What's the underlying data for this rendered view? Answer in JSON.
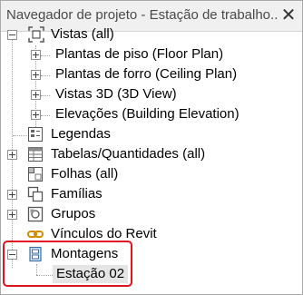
{
  "window": {
    "title": "Navegador de projeto - Estação de trabalho...",
    "close_glyph": "✕"
  },
  "tree": {
    "views": {
      "label": "Vistas (all)",
      "children": [
        "Plantas de piso (Floor Plan)",
        "Plantas de forro (Ceiling Plan)",
        "Vistas 3D (3D View)",
        "Elevações (Building Elevation)"
      ]
    },
    "legends": "Legendas",
    "schedules": "Tabelas/Quantidades (all)",
    "sheets": "Folhas (all)",
    "families": "Famílias",
    "groups": "Grupos",
    "revit_links": "Vínculos do Revit",
    "assemblies": {
      "label": "Montagens",
      "children": [
        "Estação 02"
      ]
    }
  },
  "colors": {
    "highlight_border": "#e0141e",
    "selected_background": "#e5e5e5"
  }
}
